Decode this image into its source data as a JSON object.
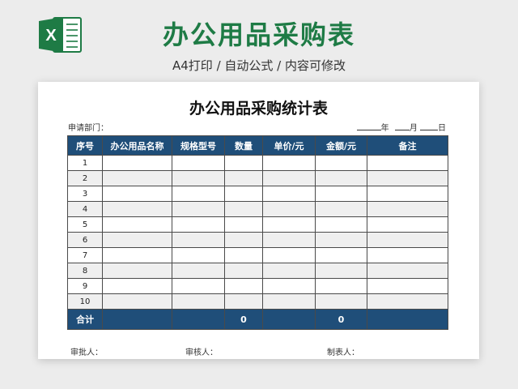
{
  "banner": {
    "icon": "excel-logo-icon",
    "title": "办公用品采购表",
    "subtitle": "A4打印 / 自动公式 / 内容可修改",
    "title_color": "#1e7b45"
  },
  "sheet": {
    "title": "办公用品采购统计表",
    "dept_label": "申请部门：",
    "date": {
      "year": "年",
      "month": "月",
      "day": "日"
    },
    "header_color": "#1f4e79",
    "columns": [
      "序号",
      "办公用品名称",
      "规格型号",
      "数量",
      "单价/元",
      "金额/元",
      "备注"
    ],
    "rows": [
      [
        "1",
        "",
        "",
        "",
        "",
        "",
        ""
      ],
      [
        "2",
        "",
        "",
        "",
        "",
        "",
        ""
      ],
      [
        "3",
        "",
        "",
        "",
        "",
        "",
        ""
      ],
      [
        "4",
        "",
        "",
        "",
        "",
        "",
        ""
      ],
      [
        "5",
        "",
        "",
        "",
        "",
        "",
        ""
      ],
      [
        "6",
        "",
        "",
        "",
        "",
        "",
        ""
      ],
      [
        "7",
        "",
        "",
        "",
        "",
        "",
        ""
      ],
      [
        "8",
        "",
        "",
        "",
        "",
        "",
        ""
      ],
      [
        "9",
        "",
        "",
        "",
        "",
        "",
        ""
      ],
      [
        "10",
        "",
        "",
        "",
        "",
        "",
        ""
      ]
    ],
    "total": [
      "合计",
      "",
      "",
      "0",
      "",
      "0",
      ""
    ],
    "footer": {
      "approver": "审批人：",
      "reviewer": "审核人：",
      "preparer": "制表人："
    }
  }
}
